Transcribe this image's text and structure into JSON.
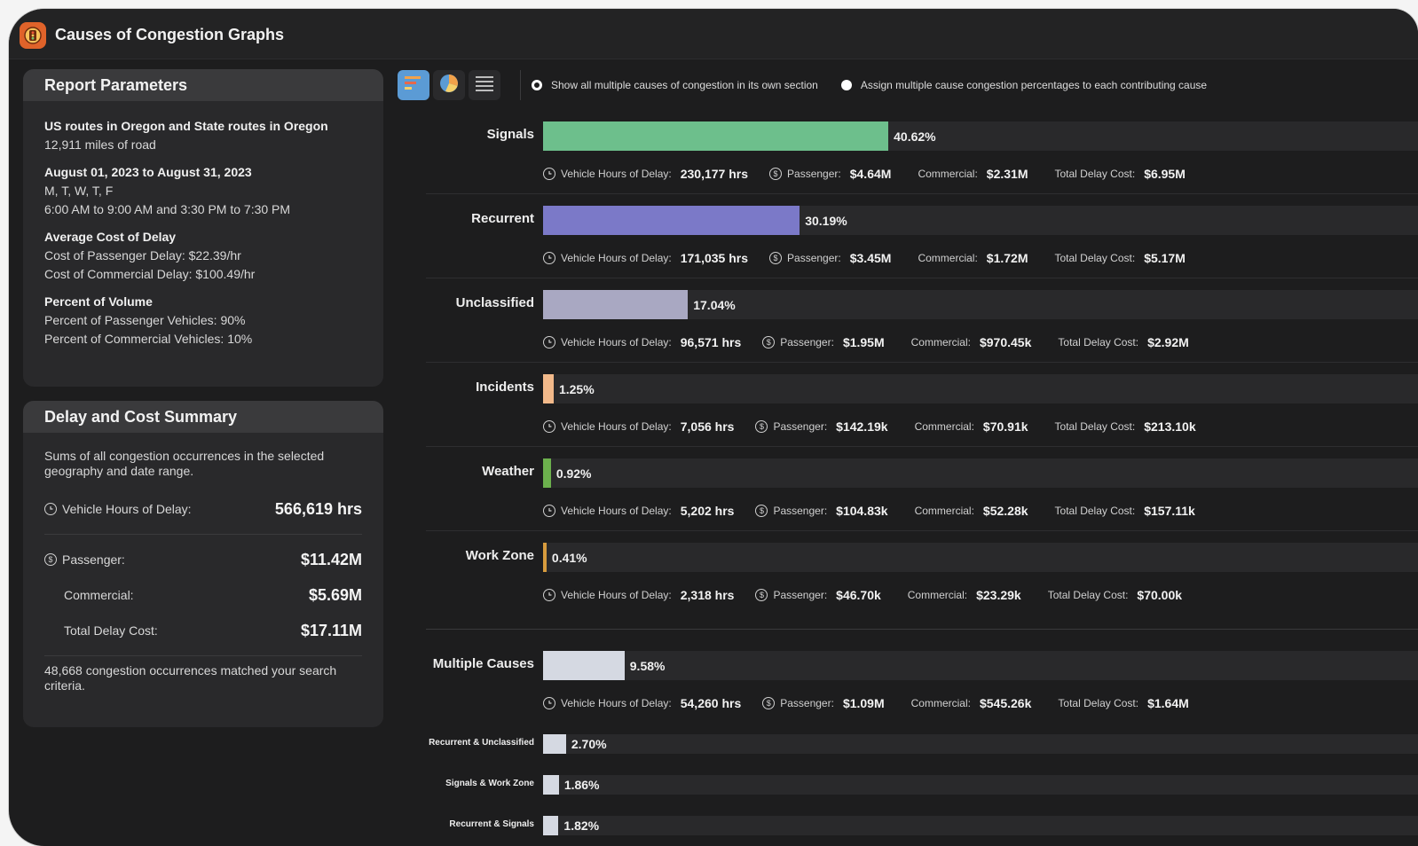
{
  "app": {
    "title": "Causes of Congestion Graphs",
    "icon": "traffic-light-icon"
  },
  "report_parameters": {
    "title": "Report Parameters",
    "groups": [
      {
        "heading": "US routes in Oregon and State routes in Oregon",
        "lines": [
          "12,911 miles of road"
        ]
      },
      {
        "heading": "August 01, 2023 to August 31, 2023",
        "lines": [
          "M, T, W, T, F",
          "6:00 AM to 9:00 AM and 3:30 PM to 7:30 PM"
        ]
      },
      {
        "heading": "Average Cost of Delay",
        "lines": [
          "Cost of Passenger Delay: $22.39/hr",
          "Cost of Commercial Delay: $100.49/hr"
        ]
      },
      {
        "heading": "Percent of Volume",
        "lines": [
          "Percent of Passenger Vehicles: 90%",
          "Percent of Commercial Vehicles: 10%"
        ]
      }
    ]
  },
  "summary": {
    "title": "Delay and Cost Summary",
    "description": "Sums of all congestion occurrences in the selected geography and date range.",
    "vehicle_hours_label": "Vehicle Hours of Delay:",
    "vehicle_hours_value": "566,619 hrs",
    "passenger_label": "Passenger:",
    "passenger_value": "$11.42M",
    "commercial_label": "Commercial:",
    "commercial_value": "$5.69M",
    "total_label": "Total Delay Cost:",
    "total_value": "$17.11M",
    "footer": "48,668 congestion occurrences matched your search criteria."
  },
  "toolbar": {
    "views": [
      {
        "name": "bar-chart-view-button",
        "icon": "bar-chart-icon",
        "active": true
      },
      {
        "name": "pie-chart-view-button",
        "icon": "pie-chart-icon",
        "active": false
      },
      {
        "name": "table-view-button",
        "icon": "table-list-icon",
        "active": false
      }
    ],
    "options": [
      {
        "label": "Show all multiple causes of congestion in its own section",
        "selected": true
      },
      {
        "label": "Assign multiple cause congestion percentages to each contributing cause",
        "selected": false
      }
    ]
  },
  "stat_labels": {
    "hours": "Vehicle Hours of Delay:",
    "passenger": "Passenger:",
    "commercial": "Commercial:",
    "total": "Total Delay Cost:"
  },
  "chart_data": {
    "type": "bar",
    "orientation": "horizontal",
    "unit": "%",
    "xlim": [
      0,
      100
    ],
    "causes": [
      {
        "label": "Signals",
        "value": 40.62,
        "pct": "40.62%",
        "color": "#6dbf8c",
        "hours": "230,177 hrs",
        "passenger": "$4.64M",
        "commercial": "$2.31M",
        "total": "$6.95M"
      },
      {
        "label": "Recurrent",
        "value": 30.19,
        "pct": "30.19%",
        "color": "#7b79c8",
        "hours": "171,035 hrs",
        "passenger": "$3.45M",
        "commercial": "$1.72M",
        "total": "$5.17M"
      },
      {
        "label": "Unclassified",
        "value": 17.04,
        "pct": "17.04%",
        "color": "#a9a8c2",
        "hours": "96,571 hrs",
        "passenger": "$1.95M",
        "commercial": "$970.45k",
        "total": "$2.92M"
      },
      {
        "label": "Incidents",
        "value": 1.25,
        "pct": "1.25%",
        "color": "#f2b98a",
        "hours": "7,056 hrs",
        "passenger": "$142.19k",
        "commercial": "$70.91k",
        "total": "$213.10k"
      },
      {
        "label": "Weather",
        "value": 0.92,
        "pct": "0.92%",
        "color": "#6cb04d",
        "hours": "5,202 hrs",
        "passenger": "$104.83k",
        "commercial": "$52.28k",
        "total": "$157.11k"
      },
      {
        "label": "Work Zone",
        "value": 0.41,
        "pct": "0.41%",
        "color": "#d79b3e",
        "hours": "2,318 hrs",
        "passenger": "$46.70k",
        "commercial": "$23.29k",
        "total": "$70.00k"
      }
    ],
    "multiple": {
      "label": "Multiple Causes",
      "value": 9.58,
      "pct": "9.58%",
      "color": "#d5d9e2",
      "hours": "54,260 hrs",
      "passenger": "$1.09M",
      "commercial": "$545.26k",
      "total": "$1.64M"
    },
    "combinations": [
      {
        "label": "Recurrent & Unclassified",
        "value": 2.7,
        "pct": "2.70%",
        "color": "#d5d9e2"
      },
      {
        "label": "Signals & Work Zone",
        "value": 1.86,
        "pct": "1.86%",
        "color": "#d5d9e2"
      },
      {
        "label": "Recurrent & Signals",
        "value": 1.82,
        "pct": "1.82%",
        "color": "#d5d9e2"
      }
    ]
  }
}
